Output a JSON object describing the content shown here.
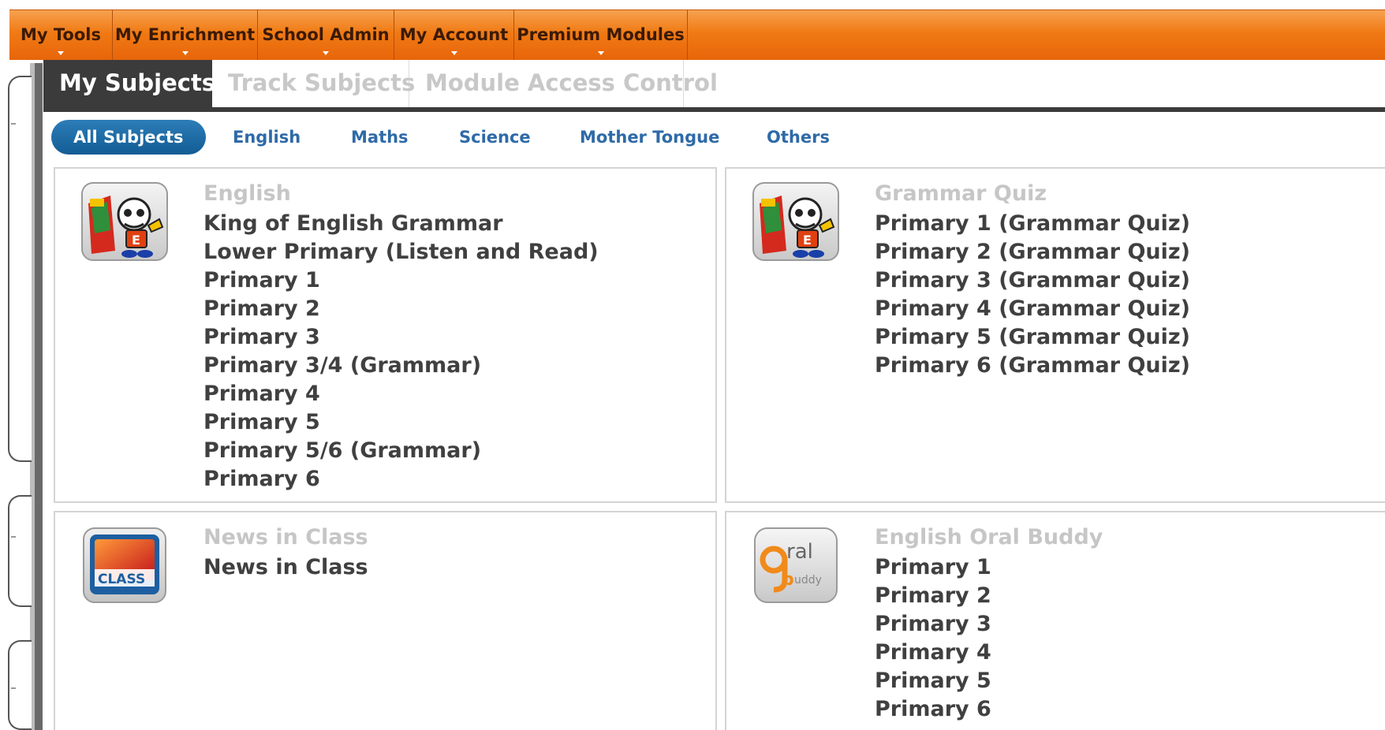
{
  "topnav": {
    "items": [
      {
        "label": "My Tools"
      },
      {
        "label": "My Enrichment"
      },
      {
        "label": "School Admin"
      },
      {
        "label": "My Account"
      },
      {
        "label": "Premium Modules"
      }
    ]
  },
  "tabs": [
    {
      "label": "My Subjects",
      "active": true
    },
    {
      "label": "Track Subjects",
      "active": false
    },
    {
      "label": "Module Access Control",
      "active": false
    }
  ],
  "filters": [
    {
      "label": "All Subjects",
      "active": true
    },
    {
      "label": "English"
    },
    {
      "label": "Maths"
    },
    {
      "label": "Science"
    },
    {
      "label": "Mother Tongue"
    },
    {
      "label": "Others"
    }
  ],
  "cards": [
    {
      "title": "English",
      "icon": "english-king-mascot-icon",
      "links": [
        "King of English Grammar",
        "Lower Primary (Listen and Read)",
        "Primary 1",
        "Primary 2",
        "Primary 3",
        "Primary 3/4 (Grammar)",
        "Primary 4",
        "Primary 5",
        "Primary 5/6 (Grammar)",
        "Primary 6"
      ]
    },
    {
      "title": "Grammar Quiz",
      "icon": "grammar-quiz-mascot-icon",
      "links": [
        "Primary 1 (Grammar Quiz)",
        "Primary 2 (Grammar Quiz)",
        "Primary 3 (Grammar Quiz)",
        "Primary 4 (Grammar Quiz)",
        "Primary 5 (Grammar Quiz)",
        "Primary 6 (Grammar Quiz)"
      ]
    },
    {
      "title": "News in Class",
      "icon": "news-in-class-tv-icon",
      "icon_text": "CLASS",
      "links": [
        "News in Class"
      ]
    },
    {
      "title": "English Oral Buddy",
      "icon": "oral-buddy-icon",
      "icon_text_top": "ral",
      "icon_text_bottom": "uddy",
      "links": [
        "Primary 1",
        "Primary 2",
        "Primary 3",
        "Primary 4",
        "Primary 5",
        "Primary 6"
      ]
    }
  ],
  "colors": {
    "nav_orange": "#f07a14",
    "tab_dark": "#3b3b3b",
    "pill_blue": "#1a6aa5",
    "link_text": "#404040",
    "card_title": "#c6c6c6"
  }
}
